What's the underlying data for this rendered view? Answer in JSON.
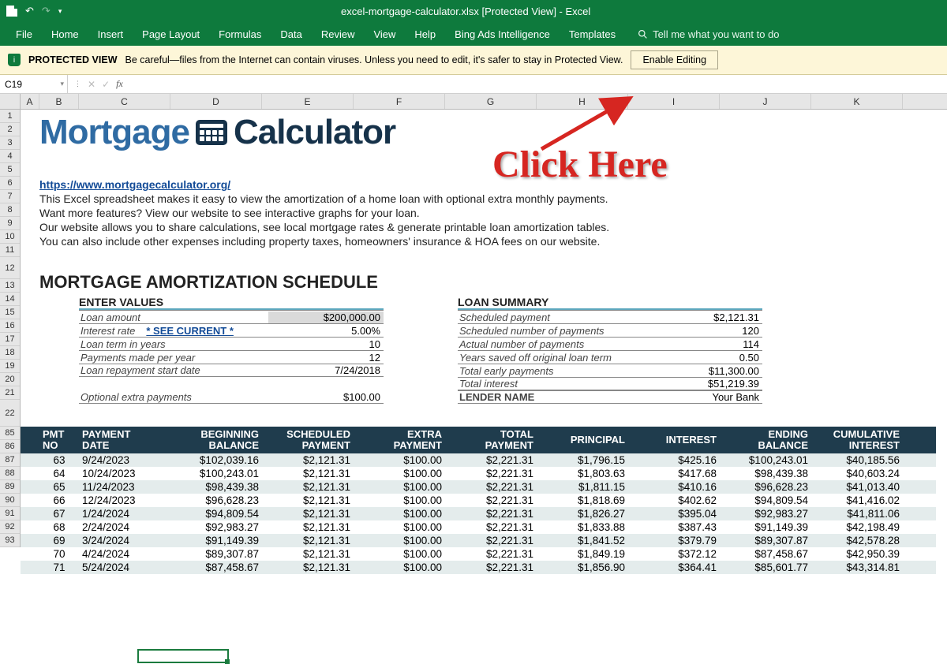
{
  "title_bar": {
    "filename": "excel-mortgage-calculator.xlsx  [Protected View]  -  Excel"
  },
  "ribbon": {
    "tabs": [
      "File",
      "Home",
      "Insert",
      "Page Layout",
      "Formulas",
      "Data",
      "Review",
      "View",
      "Help",
      "Bing Ads Intelligence",
      "Templates"
    ],
    "tell_me": "Tell me what you want to do"
  },
  "protected": {
    "label": "PROTECTED VIEW",
    "msg": "Be careful—files from the Internet can contain viruses. Unless you need to edit, it's safer to stay in Protected View.",
    "button": "Enable Editing"
  },
  "namebox": "C19",
  "columns": [
    "A",
    "B",
    "C",
    "D",
    "E",
    "F",
    "G",
    "H",
    "I",
    "J",
    "K"
  ],
  "row_numbers_top": [
    "1",
    "2",
    "3",
    "4",
    "5",
    "6",
    "7",
    "8",
    "9",
    "10",
    "11",
    "12",
    "13",
    "14",
    "15",
    "16",
    "17",
    "18",
    "19",
    "20",
    "21",
    "22"
  ],
  "row_numbers_data": [
    "85",
    "86",
    "87",
    "88",
    "89",
    "90",
    "91",
    "92",
    "93"
  ],
  "annotation": "Click Here",
  "logo": {
    "part1": "Mortgage",
    "part2": "Calculator"
  },
  "intro": {
    "url": "https://www.mortgagecalculator.org/",
    "l1": "This Excel spreadsheet makes it easy to view the amortization of a home loan with optional extra monthly payments.",
    "l2": "Want more features? View our website to see interactive graphs for your loan.",
    "l3": "Our website allows you to share calculations, see local mortgage rates & generate printable loan amortization tables.",
    "l4": "You can also include other expenses including property taxes, homeowners' insurance & HOA fees on our website."
  },
  "schedule_title": "MORTGAGE AMORTIZATION SCHEDULE",
  "inputs": {
    "header": "ENTER VALUES",
    "rows": [
      {
        "lab": "Loan amount",
        "val": "$200,000.00",
        "shade": true
      },
      {
        "lab": "Interest rate",
        "see": "* SEE CURRENT *",
        "val": "5.00%"
      },
      {
        "lab": "Loan term in years",
        "val": "10"
      },
      {
        "lab": "Payments made per year",
        "val": "12"
      },
      {
        "lab": "Loan repayment start date",
        "val": "7/24/2018"
      }
    ],
    "extra": {
      "lab": "Optional extra payments",
      "val": "$100.00"
    }
  },
  "summary": {
    "header": "LOAN SUMMARY",
    "rows": [
      {
        "lab": "Scheduled payment",
        "val": "$2,121.31"
      },
      {
        "lab": "Scheduled number of payments",
        "val": "120"
      },
      {
        "lab": "Actual number of payments",
        "val": "114"
      },
      {
        "lab": "Years saved off original loan term",
        "val": "0.50"
      },
      {
        "lab": "Total early payments",
        "val": "$11,300.00"
      },
      {
        "lab": "Total interest",
        "val": "$51,219.39"
      }
    ],
    "lender": {
      "lab": "LENDER NAME",
      "val": "Your Bank"
    }
  },
  "table": {
    "headers": [
      {
        "l1": "PMT",
        "l2": "NO"
      },
      {
        "l1": "PAYMENT",
        "l2": "DATE"
      },
      {
        "l1": "BEGINNING",
        "l2": "BALANCE"
      },
      {
        "l1": "SCHEDULED",
        "l2": "PAYMENT"
      },
      {
        "l1": "EXTRA",
        "l2": "PAYMENT"
      },
      {
        "l1": "TOTAL",
        "l2": "PAYMENT"
      },
      {
        "l1": "PRINCIPAL",
        "l2": ""
      },
      {
        "l1": "INTEREST",
        "l2": ""
      },
      {
        "l1": "ENDING",
        "l2": "BALANCE"
      },
      {
        "l1": "CUMULATIVE",
        "l2": "INTEREST"
      }
    ],
    "rows": [
      {
        "no": "63",
        "date": "9/24/2023",
        "bb": "$102,039.16",
        "sp": "$2,121.31",
        "ep": "$100.00",
        "tp": "$2,221.31",
        "pr": "$1,796.15",
        "in": "$425.16",
        "eb": "$100,243.01",
        "ci": "$40,185.56"
      },
      {
        "no": "64",
        "date": "10/24/2023",
        "bb": "$100,243.01",
        "sp": "$2,121.31",
        "ep": "$100.00",
        "tp": "$2,221.31",
        "pr": "$1,803.63",
        "in": "$417.68",
        "eb": "$98,439.38",
        "ci": "$40,603.24"
      },
      {
        "no": "65",
        "date": "11/24/2023",
        "bb": "$98,439.38",
        "sp": "$2,121.31",
        "ep": "$100.00",
        "tp": "$2,221.31",
        "pr": "$1,811.15",
        "in": "$410.16",
        "eb": "$96,628.23",
        "ci": "$41,013.40"
      },
      {
        "no": "66",
        "date": "12/24/2023",
        "bb": "$96,628.23",
        "sp": "$2,121.31",
        "ep": "$100.00",
        "tp": "$2,221.31",
        "pr": "$1,818.69",
        "in": "$402.62",
        "eb": "$94,809.54",
        "ci": "$41,416.02"
      },
      {
        "no": "67",
        "date": "1/24/2024",
        "bb": "$94,809.54",
        "sp": "$2,121.31",
        "ep": "$100.00",
        "tp": "$2,221.31",
        "pr": "$1,826.27",
        "in": "$395.04",
        "eb": "$92,983.27",
        "ci": "$41,811.06"
      },
      {
        "no": "68",
        "date": "2/24/2024",
        "bb": "$92,983.27",
        "sp": "$2,121.31",
        "ep": "$100.00",
        "tp": "$2,221.31",
        "pr": "$1,833.88",
        "in": "$387.43",
        "eb": "$91,149.39",
        "ci": "$42,198.49"
      },
      {
        "no": "69",
        "date": "3/24/2024",
        "bb": "$91,149.39",
        "sp": "$2,121.31",
        "ep": "$100.00",
        "tp": "$2,221.31",
        "pr": "$1,841.52",
        "in": "$379.79",
        "eb": "$89,307.87",
        "ci": "$42,578.28"
      },
      {
        "no": "70",
        "date": "4/24/2024",
        "bb": "$89,307.87",
        "sp": "$2,121.31",
        "ep": "$100.00",
        "tp": "$2,221.31",
        "pr": "$1,849.19",
        "in": "$372.12",
        "eb": "$87,458.67",
        "ci": "$42,950.39"
      },
      {
        "no": "71",
        "date": "5/24/2024",
        "bb": "$87,458.67",
        "sp": "$2,121.31",
        "ep": "$100.00",
        "tp": "$2,221.31",
        "pr": "$1,856.90",
        "in": "$364.41",
        "eb": "$85,601.77",
        "ci": "$43,314.81"
      }
    ]
  }
}
